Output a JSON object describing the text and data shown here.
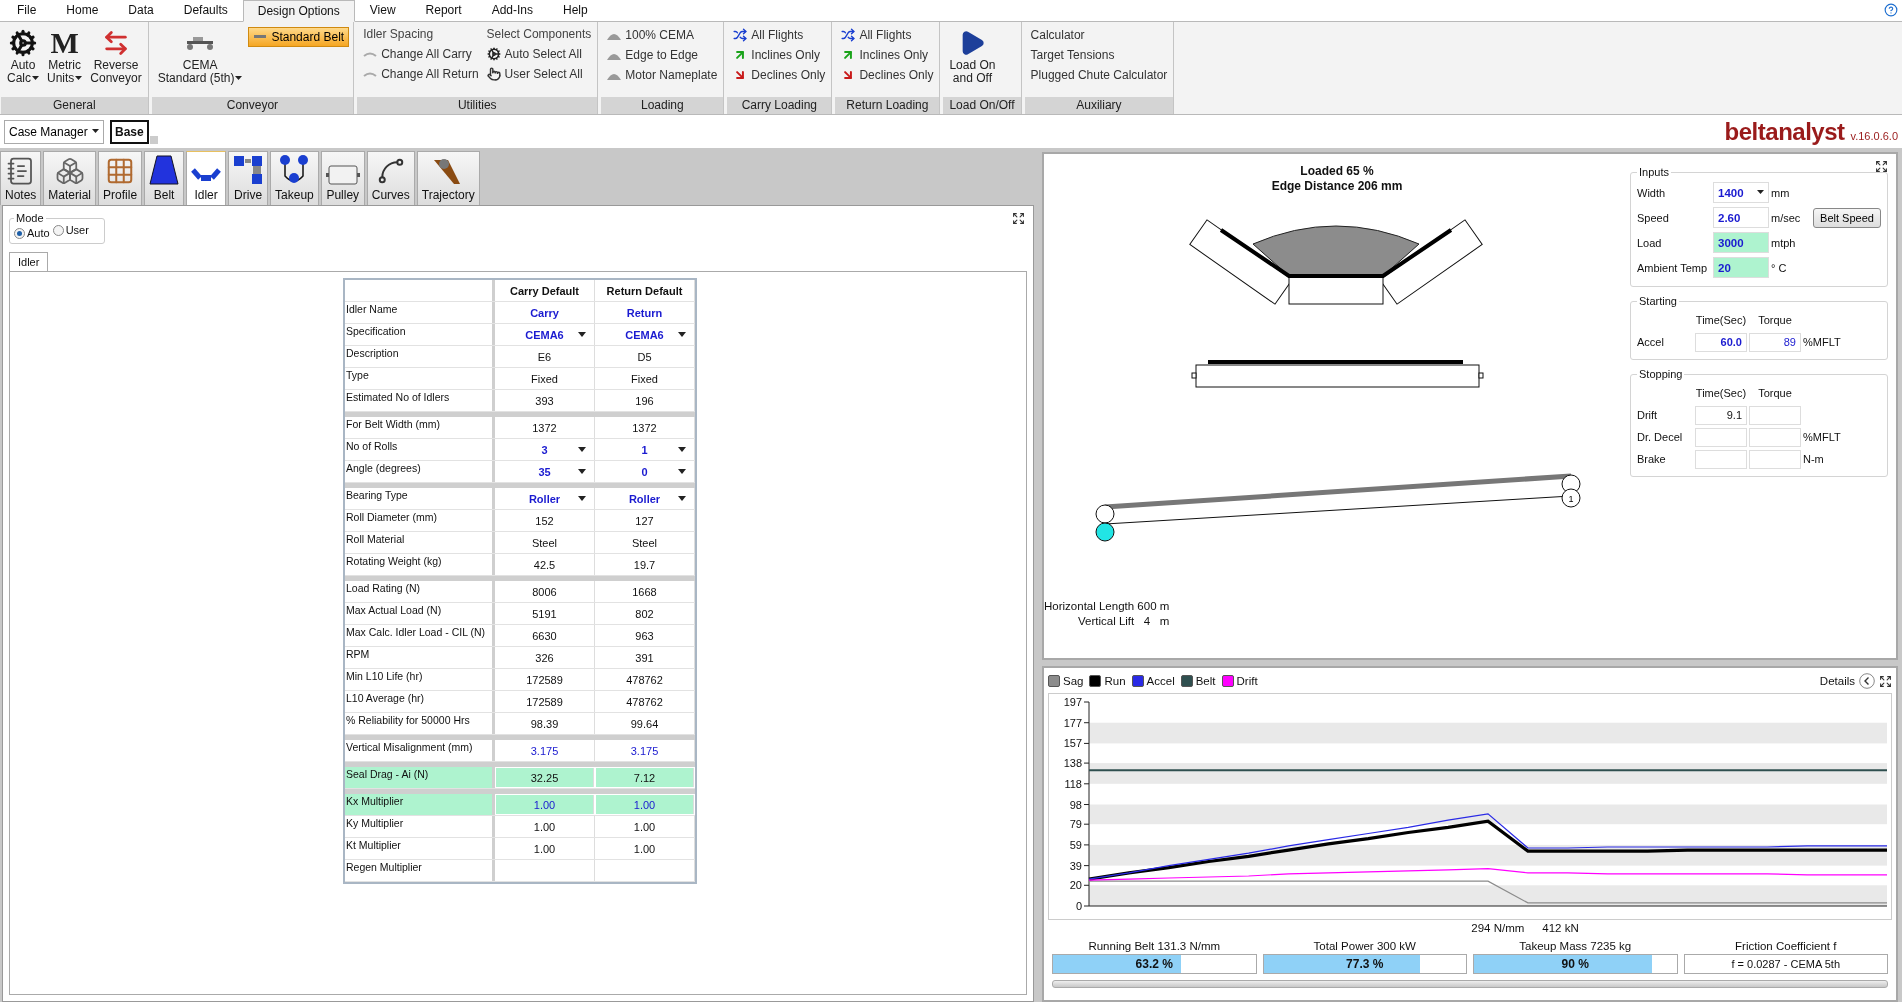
{
  "menu": [
    {
      "label": "File",
      "selected": false
    },
    {
      "label": "Home",
      "selected": false
    },
    {
      "label": "Data",
      "selected": false
    },
    {
      "label": "Defaults",
      "selected": false
    },
    {
      "label": "Design Options",
      "selected": true
    },
    {
      "label": "View",
      "selected": false
    },
    {
      "label": "Report",
      "selected": false
    },
    {
      "label": "Add-Ins",
      "selected": false
    },
    {
      "label": "Help",
      "selected": false
    }
  ],
  "ribbon": {
    "groups": [
      {
        "label": "General",
        "columns": [
          [
            {
              "kind": "large",
              "lines": [
                "Auto",
                "Calc"
              ],
              "dropdown": true
            }
          ],
          [
            {
              "kind": "large",
              "glyph": "M",
              "lines": [
                "Metric",
                "Units"
              ],
              "dropdown": true
            }
          ],
          [
            {
              "kind": "large",
              "lines": [
                "Reverse",
                "Conveyor"
              ],
              "dropdown": false
            }
          ]
        ]
      },
      {
        "label": "Conveyor",
        "columns": [
          [
            {
              "kind": "large",
              "lines": [
                "CEMA",
                "Standard (5th)"
              ],
              "dropdown": true
            }
          ],
          [
            {
              "kind": "toggle",
              "label": "Standard Belt",
              "selected": true
            }
          ]
        ]
      },
      {
        "label": "Utilities",
        "columns": [
          [
            {
              "kind": "header",
              "label": "Idler Spacing"
            },
            {
              "kind": "small",
              "label": "Change All Carry"
            },
            {
              "kind": "small",
              "label": "Change All Return"
            }
          ],
          [
            {
              "kind": "header",
              "label": "Select Components"
            },
            {
              "kind": "small",
              "label": "Auto Select All"
            },
            {
              "kind": "small",
              "label": "User Select All"
            }
          ]
        ]
      },
      {
        "label": "Loading",
        "columns": [
          [
            {
              "kind": "small",
              "label": "100% CEMA"
            },
            {
              "kind": "small",
              "label": "Edge to Edge"
            },
            {
              "kind": "small",
              "label": "Motor Nameplate"
            }
          ]
        ]
      },
      {
        "label": "Carry Loading",
        "columns": [
          [
            {
              "kind": "small",
              "label": "All Flights"
            },
            {
              "kind": "small",
              "label": "Inclines Only"
            },
            {
              "kind": "small",
              "label": "Declines Only"
            }
          ]
        ]
      },
      {
        "label": "Return Loading",
        "columns": [
          [
            {
              "kind": "small",
              "label": "All Flights"
            },
            {
              "kind": "small",
              "label": "Inclines Only"
            },
            {
              "kind": "small",
              "label": "Declines Only"
            }
          ]
        ]
      },
      {
        "label": "Load On/Off",
        "columns": [
          [
            {
              "kind": "large",
              "lines": [
                "Load On",
                "and Off"
              ],
              "dropdown": false
            }
          ]
        ]
      },
      {
        "label": "Auxiliary",
        "columns": [
          [
            {
              "kind": "small",
              "label": "Calculator"
            },
            {
              "kind": "small",
              "label": "Target Tensions"
            },
            {
              "kind": "small",
              "label": "Plugged Chute Calculator"
            }
          ]
        ]
      }
    ]
  },
  "case_bar": {
    "case_manager": "Case Manager",
    "case": "Base",
    "logo": "beltanalyst",
    "version": "v.16.0.6.0"
  },
  "modules": [
    {
      "label": "Notes",
      "selected": false
    },
    {
      "label": "Material",
      "selected": false
    },
    {
      "label": "Profile",
      "selected": false
    },
    {
      "label": "Belt",
      "selected": false
    },
    {
      "label": "Idler",
      "selected": true
    },
    {
      "label": "Drive",
      "selected": false
    },
    {
      "label": "Takeup",
      "selected": false
    },
    {
      "label": "Pulley",
      "selected": false
    },
    {
      "label": "Curves",
      "selected": false
    },
    {
      "label": "Trajectory",
      "selected": false
    }
  ],
  "mode": {
    "title": "Mode",
    "options": [
      {
        "label": "Auto",
        "selected": true
      },
      {
        "label": "User",
        "selected": false
      }
    ]
  },
  "panel_tabs": [
    {
      "label": "Idler",
      "selected": true
    }
  ],
  "table": {
    "columns": [
      "Carry Default",
      "Return Default"
    ],
    "groups": [
      {
        "rows": [
          {
            "label": "Idler Name",
            "values": [
              "Carry",
              "Return"
            ],
            "kind": "name",
            "highlighted": false
          },
          {
            "label": "Specification",
            "values": [
              "CEMA6",
              "CEMA6"
            ],
            "kind": "dropdown",
            "highlighted": false
          },
          {
            "label": "Description",
            "values": [
              "E6",
              "D5"
            ],
            "kind": "plain",
            "highlighted": false
          },
          {
            "label": "Type",
            "values": [
              "Fixed",
              "Fixed"
            ],
            "kind": "plain",
            "highlighted": false
          },
          {
            "label": "Estimated No of Idlers",
            "values": [
              "393",
              "196"
            ],
            "kind": "plain",
            "highlighted": false
          }
        ]
      },
      {
        "rows": [
          {
            "label": "For Belt Width (mm)",
            "values": [
              "1372",
              "1372"
            ],
            "kind": "plain",
            "highlighted": false
          },
          {
            "label": "No of Rolls",
            "values": [
              "3",
              "1"
            ],
            "kind": "dropdown",
            "highlighted": false
          },
          {
            "label": "Angle (degrees)",
            "values": [
              "35",
              "0"
            ],
            "kind": "dropdown",
            "highlighted": false
          }
        ]
      },
      {
        "rows": [
          {
            "label": "Bearing Type",
            "values": [
              "Roller",
              "Roller"
            ],
            "kind": "dropdown",
            "highlighted": false
          },
          {
            "label": "Roll Diameter (mm)",
            "values": [
              "152",
              "127"
            ],
            "kind": "plain",
            "highlighted": false
          },
          {
            "label": "Roll Material",
            "values": [
              "Steel",
              "Steel"
            ],
            "kind": "plain",
            "highlighted": false
          },
          {
            "label": "Rotating Weight (kg)",
            "values": [
              "42.5",
              "19.7"
            ],
            "kind": "plain",
            "highlighted": false
          }
        ]
      },
      {
        "rows": [
          {
            "label": "Load Rating (N)",
            "values": [
              "8006",
              "1668"
            ],
            "kind": "plain",
            "highlighted": false
          },
          {
            "label": "Max Actual Load (N)",
            "values": [
              "5191",
              "802"
            ],
            "kind": "plain",
            "highlighted": false
          },
          {
            "label": "Max Calc. Idler Load - CIL (N)",
            "values": [
              "6630",
              "963"
            ],
            "kind": "plain",
            "highlighted": false
          },
          {
            "label": "RPM",
            "values": [
              "326",
              "391"
            ],
            "kind": "plain",
            "highlighted": false
          },
          {
            "label": "Min L10 Life (hr)",
            "values": [
              "172589",
              "478762"
            ],
            "kind": "plain",
            "highlighted": false
          },
          {
            "label": "L10 Average (hr)",
            "values": [
              "172589",
              "478762"
            ],
            "kind": "plain",
            "highlighted": false
          },
          {
            "label": "% Reliability for 50000 Hrs",
            "values": [
              "98.39",
              "99.64"
            ],
            "kind": "plain",
            "highlighted": false
          }
        ]
      },
      {
        "rows": [
          {
            "label": "Vertical Misalignment (mm)",
            "values": [
              "3.175",
              "3.175"
            ],
            "kind": "input",
            "highlighted": false
          }
        ]
      },
      {
        "rows": [
          {
            "label": "Seal Drag - Ai (N)",
            "values": [
              "32.25",
              "7.12"
            ],
            "kind": "plain",
            "highlighted": true
          }
        ]
      },
      {
        "rows": [
          {
            "label": "Kx Multiplier",
            "values": [
              "1.00",
              "1.00"
            ],
            "kind": "input",
            "highlighted": true
          },
          {
            "label": "Ky Multiplier",
            "values": [
              "1.00",
              "1.00"
            ],
            "kind": "plain",
            "highlighted": false
          },
          {
            "label": "Kt Multiplier",
            "values": [
              "1.00",
              "1.00"
            ],
            "kind": "plain",
            "highlighted": false
          },
          {
            "label": "Regen Multiplier",
            "values": [],
            "highlighted": false
          }
        ]
      }
    ]
  },
  "view": {
    "title": [
      "Loaded 65 %",
      "Edge Distance 206 mm"
    ],
    "pulley_number": "1",
    "notes": [
      "Horizontal Length 600 m",
      "Vertical Lift   4   m"
    ]
  },
  "inputs": {
    "title": "Inputs",
    "fields": [
      {
        "label": "Width",
        "value": "1400",
        "kind": "dropdown",
        "unit": "mm",
        "highlighted": false
      },
      {
        "label": "Speed",
        "value": "2.60",
        "kind": "entry",
        "unit": "m/sec",
        "highlighted": false,
        "button": "Belt Speed"
      },
      {
        "label": "Load",
        "value": "3000",
        "kind": "entry",
        "unit": "mtph",
        "highlighted": true
      },
      {
        "label": "Ambient Temp",
        "value": "20",
        "kind": "entry",
        "unit": "° C",
        "highlighted": true
      }
    ]
  },
  "starting": {
    "title": "Starting",
    "headers": [
      "Time(Sec)",
      "Torque"
    ],
    "rows": [
      {
        "label": "Accel",
        "cells": [
          {
            "text": "60.0",
            "bold": true,
            "entered": true
          },
          {
            "text": "89",
            "bold": false,
            "entered": true
          }
        ],
        "unit": "%MFLT"
      }
    ]
  },
  "stopping": {
    "title": "Stopping",
    "headers": [
      "Time(Sec)",
      "Torque"
    ],
    "rows": [
      {
        "label": "Drift",
        "cells": [
          {
            "text": "9.1",
            "bold": false,
            "entered": false
          }
        ]
      },
      {
        "label": "Dr. Decel",
        "cells": [],
        "unit": "%MFLT"
      },
      {
        "label": "Brake",
        "cells": [],
        "unit": "N-m"
      }
    ]
  },
  "chart": {
    "details": "Details",
    "footer": [
      "294 N/mm",
      "412 kN"
    ],
    "chart_data": {
      "type": "line",
      "categories": [
        null,
        null,
        null,
        null,
        null,
        null,
        null,
        null,
        null,
        null,
        null,
        null,
        null,
        null,
        null,
        null,
        null,
        null,
        null,
        null,
        null
      ],
      "ylim": [
        0,
        197
      ],
      "yticks": [
        0,
        20,
        39,
        59,
        79,
        98,
        118,
        138,
        157,
        177,
        197
      ],
      "series": [
        {
          "name": "Sag",
          "color": "#8c8c8c",
          "values": [
            24,
            24,
            24,
            24,
            24,
            24,
            24,
            24,
            24,
            24,
            24,
            3,
            3,
            3,
            3,
            3,
            3,
            3,
            3,
            3,
            3
          ]
        },
        {
          "name": "Run",
          "color": "#000000",
          "values": [
            26,
            32,
            37,
            43,
            48,
            54,
            60,
            65,
            71,
            76,
            82,
            53,
            53,
            53,
            53,
            54,
            54,
            54,
            54,
            54,
            54
          ]
        },
        {
          "name": "Accel",
          "color": "#2a2ae6",
          "values": [
            26,
            32,
            39,
            45,
            51,
            58,
            64,
            70,
            76,
            83,
            89,
            56,
            56,
            57,
            57,
            57,
            57,
            57,
            58,
            58,
            58
          ]
        },
        {
          "name": "Belt",
          "color": "#2f4f4f",
          "values": [
            131,
            131,
            131,
            131,
            131,
            131,
            131,
            131,
            131,
            131,
            131,
            131,
            131,
            131,
            131,
            131,
            131,
            131,
            131,
            131,
            131
          ]
        },
        {
          "name": "Drift",
          "color": "#ff00ff",
          "values": [
            25,
            26,
            27,
            28,
            29,
            31,
            32,
            33,
            34,
            35,
            36,
            32,
            32,
            31,
            31,
            31,
            31,
            31,
            30,
            30,
            30
          ]
        }
      ]
    }
  },
  "meters": [
    {
      "kind": "meter",
      "label": "Running Belt 131.3 N/mm",
      "level": 0.632,
      "reading": "63.2 %"
    },
    {
      "kind": "meter",
      "label": "Total Power 300 kW",
      "level": 0.773,
      "reading": "77.3 %"
    },
    {
      "kind": "meter",
      "label": "Takeup Mass 7235 kg",
      "level": 0.88,
      "reading": "90 %"
    },
    {
      "kind": "readout",
      "label": "Friction Coefficient f",
      "reading": "f = 0.0287 - CEMA 5th"
    }
  ]
}
